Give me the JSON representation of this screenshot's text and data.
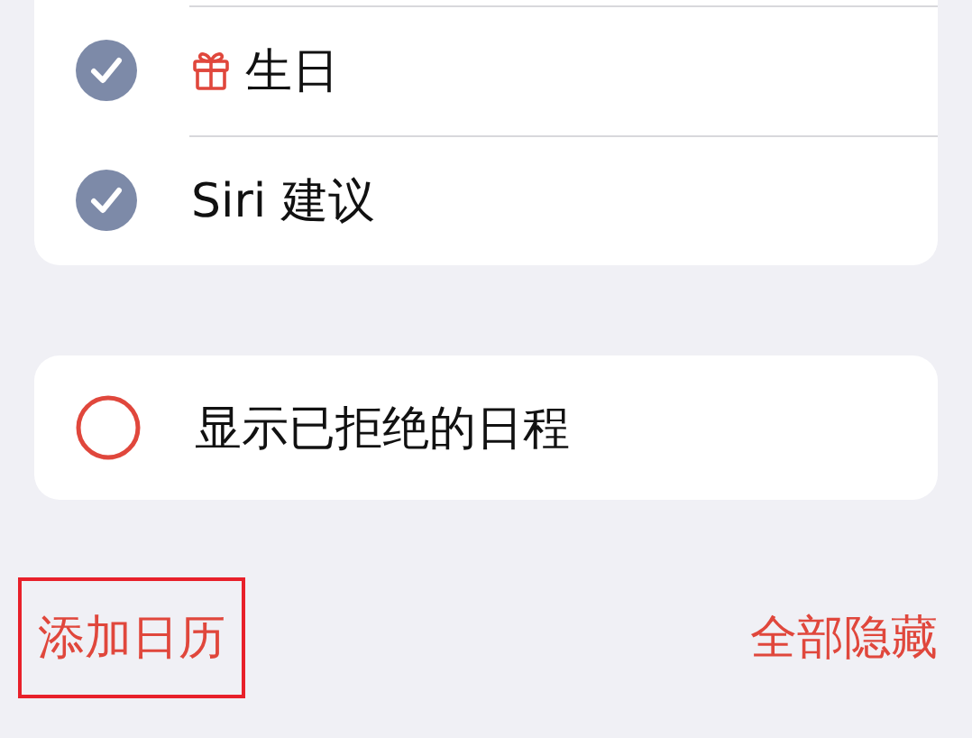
{
  "calendars": [
    {
      "label": "生日",
      "checked": true,
      "kind": "gift"
    },
    {
      "label": "Siri 建议",
      "checked": true,
      "kind": "plain"
    }
  ],
  "declined": {
    "label": "显示已拒绝的日程",
    "checked": false
  },
  "footer": {
    "add": {
      "label": "添加日历",
      "highlighted": true
    },
    "hide_all": {
      "label": "全部隐藏"
    }
  }
}
